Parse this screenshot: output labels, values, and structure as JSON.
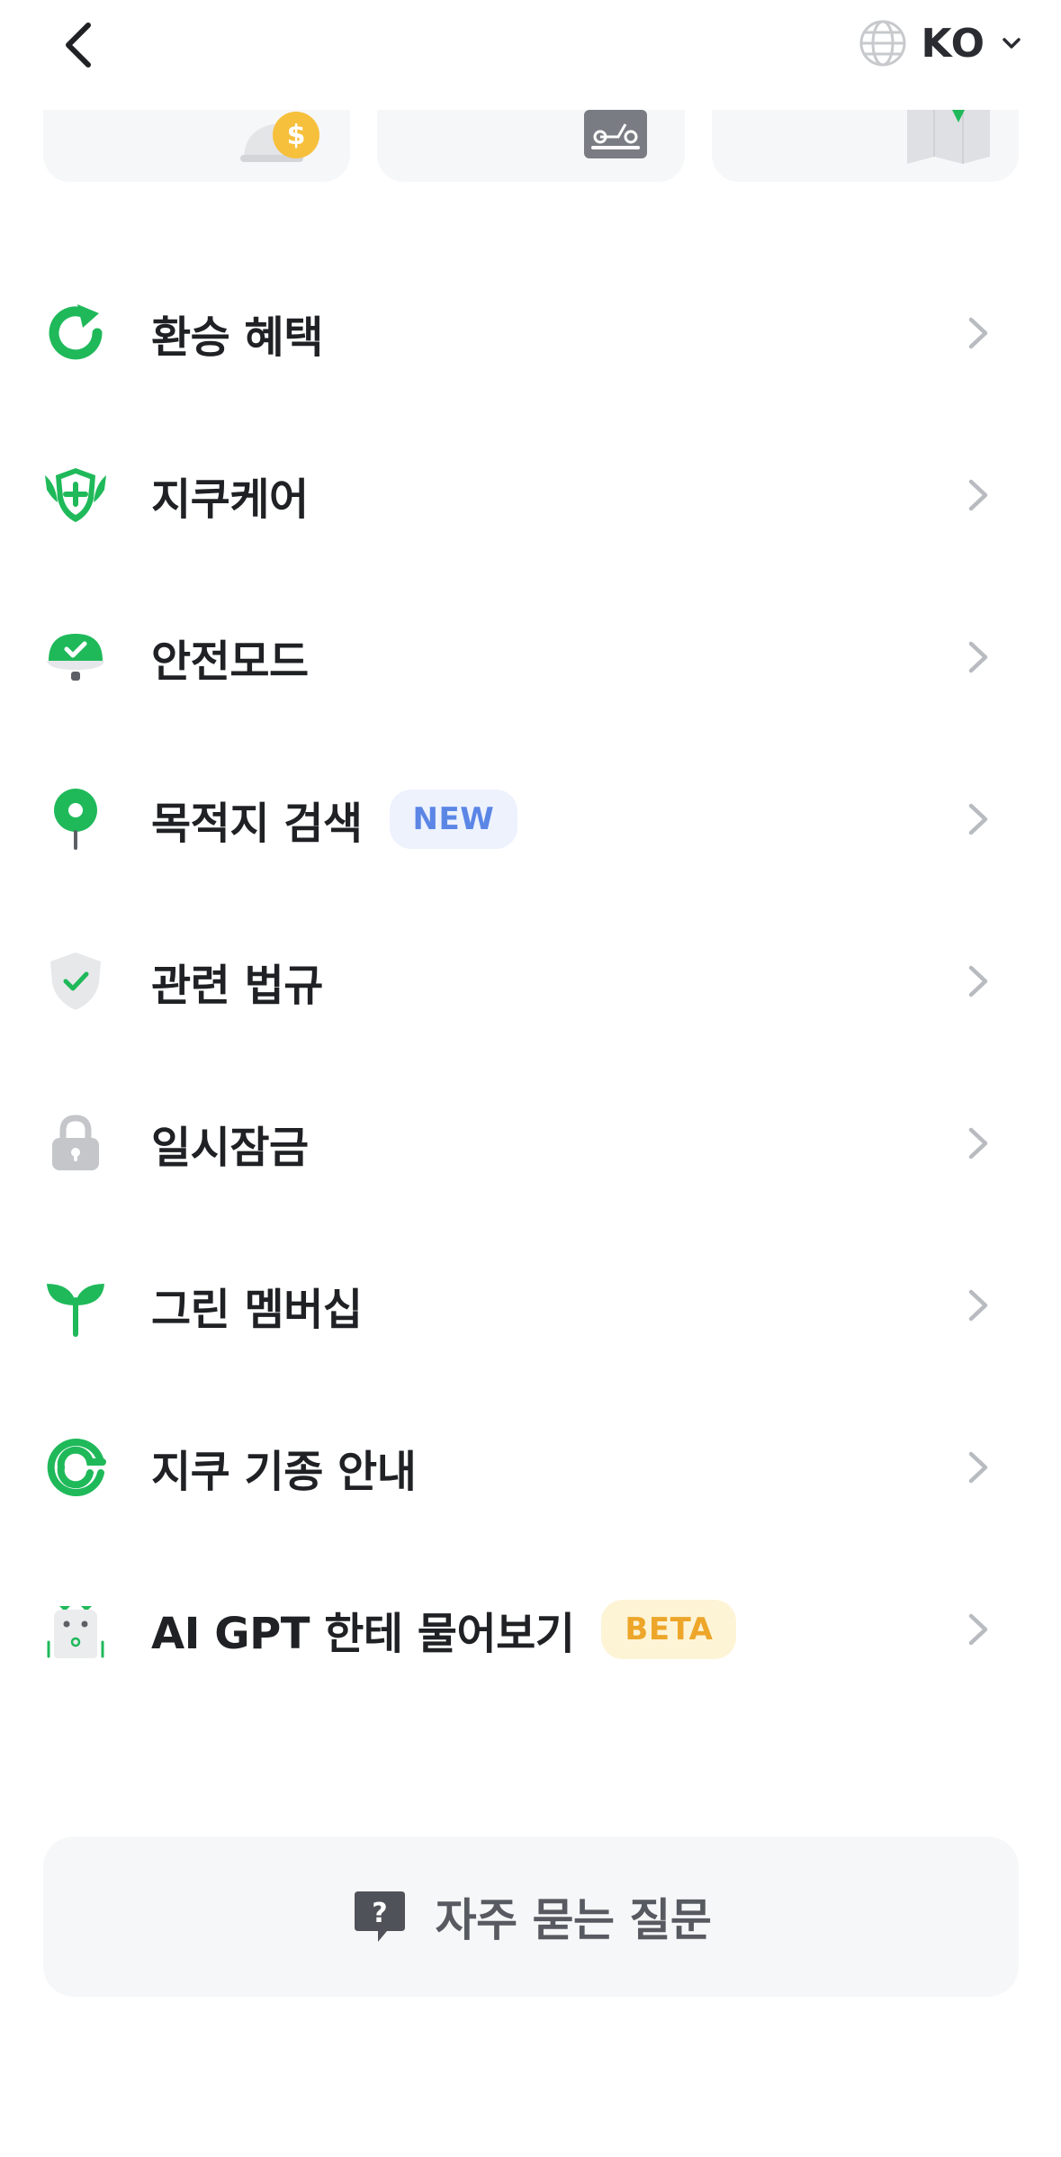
{
  "header": {
    "back_icon": "chevron-left-icon",
    "language": {
      "code": "KO",
      "icon": "globe-icon",
      "dropdown_icon": "chevron-down-icon"
    }
  },
  "service_cards": [
    {
      "icon": "helmet-coin-icon"
    },
    {
      "icon": "scooter-card-icon"
    },
    {
      "icon": "map-pin-icon"
    }
  ],
  "menu": {
    "items": [
      {
        "label": "환승 혜택",
        "icon": "refresh-arrow-icon"
      },
      {
        "label": "지쿠케어",
        "icon": "shield-plus-icon"
      },
      {
        "label": "안전모드",
        "icon": "helmet-check-icon"
      },
      {
        "label": "목적지 검색",
        "icon": "location-pin-icon",
        "badge": "NEW"
      },
      {
        "label": "관련 법규",
        "icon": "shield-check-icon"
      },
      {
        "label": "일시잠금",
        "icon": "lock-icon"
      },
      {
        "label": "그린 멤버십",
        "icon": "sprout-icon"
      },
      {
        "label": "지쿠 기종 안내",
        "icon": "gcoo-logo-icon"
      },
      {
        "label": "AI GPT 한테 물어보기",
        "icon": "robot-icon",
        "badge": "BETA"
      }
    ]
  },
  "faq": {
    "label": "자주 묻는 질문",
    "icon": "question-bubble-icon"
  },
  "colors": {
    "accent_green": "#1fb95a",
    "badge_new_bg": "#edf2fd",
    "badge_new_text": "#5b86e6",
    "badge_beta_bg": "#fdf4d6",
    "badge_beta_text": "#eda62a",
    "chevron": "#b8bbbf"
  }
}
